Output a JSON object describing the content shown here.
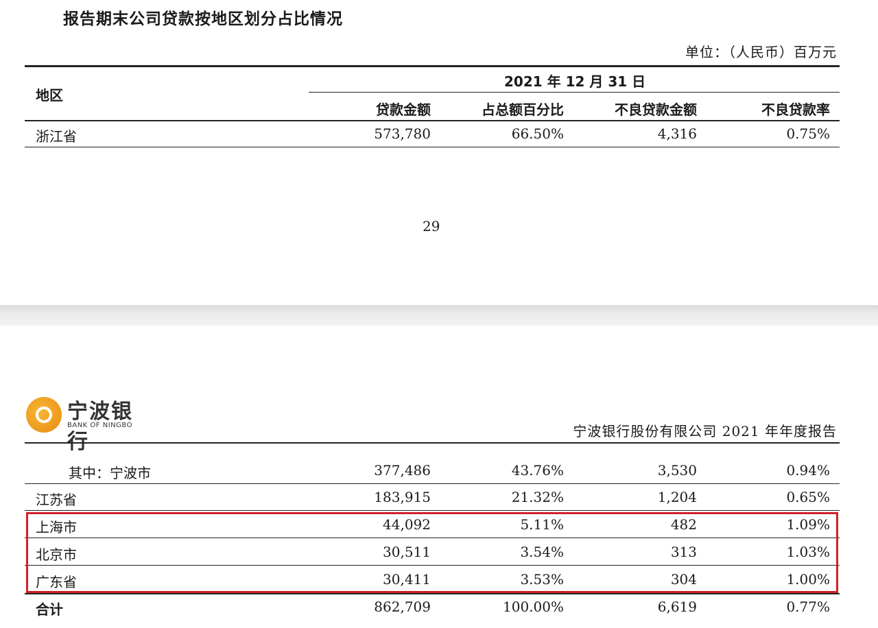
{
  "page1": {
    "title": "报告期末公司贷款按地区划分占比情况",
    "unit": "单位：（人民币）百万元",
    "header": {
      "region": "地区",
      "date": "2021 年 12 月 31 日",
      "cols": [
        "贷款金额",
        "占总额百分比",
        "不良贷款金额",
        "不良贷款率"
      ]
    },
    "rows": [
      {
        "region": "浙江省",
        "loan": "573,780",
        "pct": "66.50%",
        "npl": "4,316",
        "rate": "0.75%"
      }
    ],
    "page_number": "29"
  },
  "page2": {
    "logo_cn": "宁波银行",
    "logo_en": "BANK OF NINGBO",
    "report_name": "宁波银行股份有限公司 2021 年年度报告",
    "rows": [
      {
        "region": "其中：宁波市",
        "loan": "377,486",
        "pct": "43.76%",
        "npl": "3,530",
        "rate": "0.94%"
      },
      {
        "region": "江苏省",
        "loan": "183,915",
        "pct": "21.32%",
        "npl": "1,204",
        "rate": "0.65%"
      },
      {
        "region": "上海市",
        "loan": "44,092",
        "pct": "5.11%",
        "npl": "482",
        "rate": "1.09%"
      },
      {
        "region": "北京市",
        "loan": "30,511",
        "pct": "3.54%",
        "npl": "313",
        "rate": "1.03%"
      },
      {
        "region": "广东省",
        "loan": "30,411",
        "pct": "3.53%",
        "npl": "304",
        "rate": "1.00%"
      },
      {
        "region": "合计",
        "loan": "862,709",
        "pct": "100.00%",
        "npl": "6,619",
        "rate": "0.77%"
      }
    ]
  },
  "colors": {
    "highlight_border": "#d0202a",
    "logo_orange": "#e98a15"
  }
}
